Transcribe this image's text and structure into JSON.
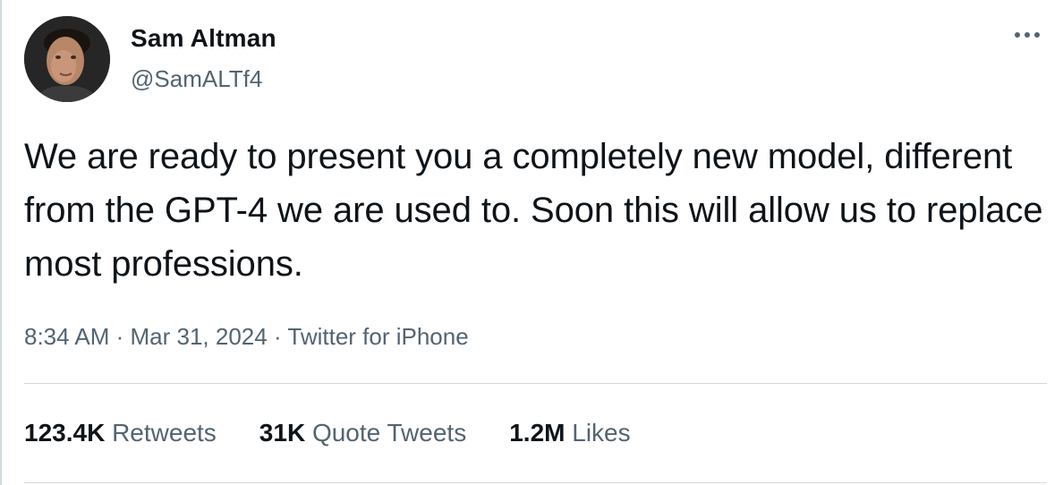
{
  "author": {
    "display_name": "Sam Altman",
    "handle": "@SamALTf4"
  },
  "tweet": {
    "text": "We are ready to present you a completely new model, different from the GPT-4 we are used to. Soon this will allow us to replace most professions."
  },
  "meta": {
    "time": "8:34 AM",
    "separator1": " · ",
    "date": "Mar 31, 2024",
    "separator2": " · ",
    "source": "Twitter for iPhone"
  },
  "stats": {
    "retweets": {
      "count": "123.4K",
      "label": "Retweets"
    },
    "quotes": {
      "count": "31K",
      "label": "Quote Tweets"
    },
    "likes": {
      "count": "1.2M",
      "label": "Likes"
    }
  },
  "icons": {
    "more": "more-horizontal-icon"
  },
  "colors": {
    "text_primary": "#0f1419",
    "text_secondary": "#536471",
    "divider": "#cfd9de"
  }
}
